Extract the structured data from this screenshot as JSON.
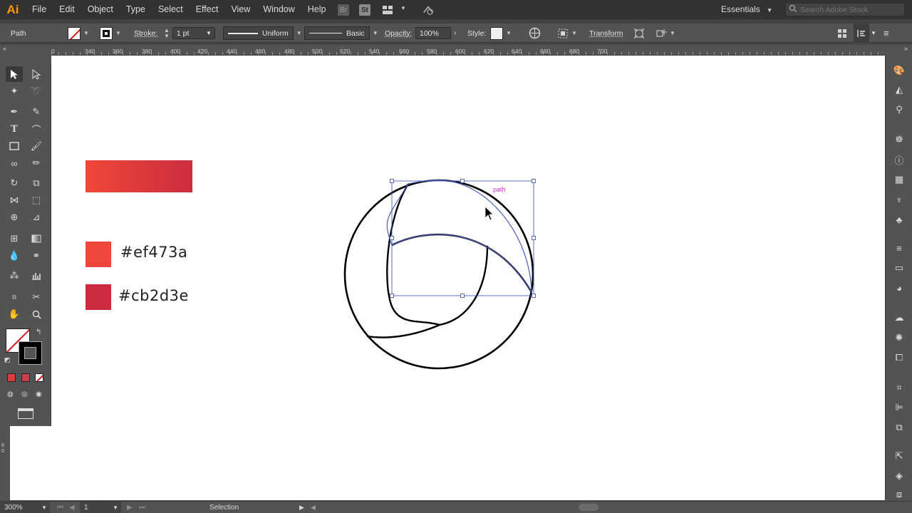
{
  "app": {
    "logo": "Ai"
  },
  "menu": [
    "File",
    "Edit",
    "Object",
    "Type",
    "Select",
    "Effect",
    "View",
    "Window",
    "Help"
  ],
  "menubar_icons": {
    "bridge": "Br",
    "stock": "St"
  },
  "workspace": "Essentials",
  "search": {
    "placeholder": "Search Adobe Stock"
  },
  "control": {
    "selection_type": "Path",
    "stroke_label": "Stroke:",
    "stroke_weight": "1 pt",
    "profile": "Uniform",
    "brush": "Basic",
    "opacity_label": "Opacity:",
    "opacity_value": "100%",
    "style_label": "Style:",
    "transform_label": "Transform"
  },
  "ruler": {
    "ticks": [
      "0",
      "340",
      "360",
      "380",
      "400",
      "420",
      "440",
      "460",
      "480",
      "500",
      "520",
      "540",
      "560",
      "580",
      "600",
      "620",
      "640",
      "660",
      "680",
      "700"
    ]
  },
  "artboard": {
    "color_1": {
      "hex": "#ef473a",
      "label": "#ef473a"
    },
    "color_2": {
      "hex": "#cb2d3e",
      "label": "#cb2d3e"
    },
    "hover_label": "path"
  },
  "status": {
    "zoom": "300%",
    "artboard_number": "1",
    "tool": "Selection"
  },
  "colors": {
    "selection_blue": "#4a5dbd",
    "hover_magenta": "#cc33cc",
    "ui_dark": "#323232",
    "ui_mid": "#535353"
  }
}
